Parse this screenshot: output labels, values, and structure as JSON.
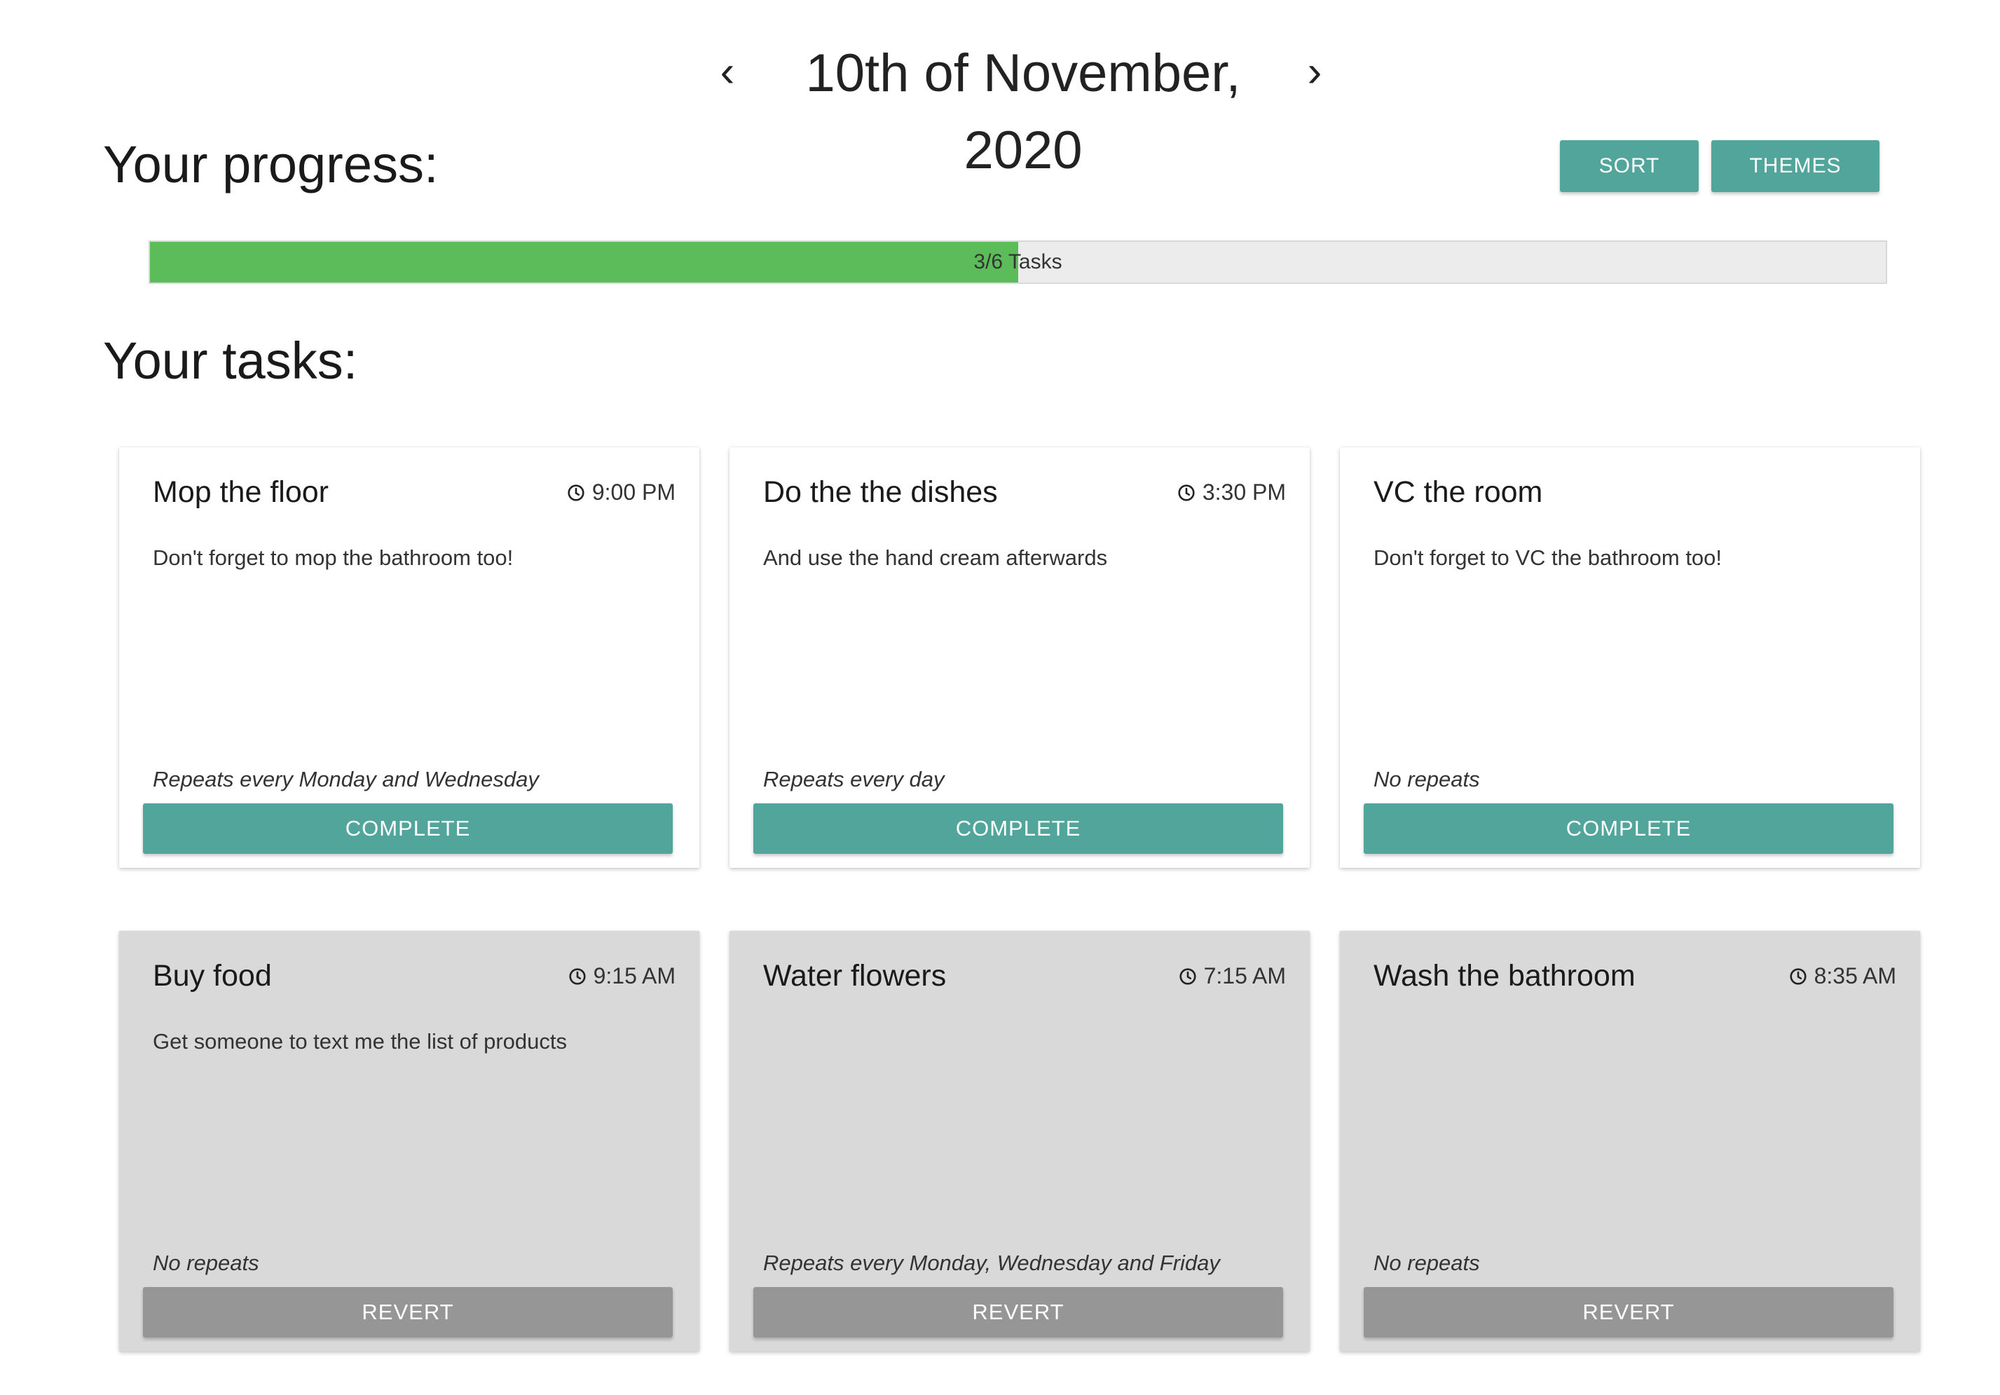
{
  "header": {
    "date": "10th of November, 2020",
    "prev_glyph": "‹",
    "next_glyph": "›"
  },
  "progress": {
    "title": "Your progress:",
    "label": "3/6 Tasks",
    "completed": 3,
    "total": 6,
    "fill_color": "#5cbc5a"
  },
  "toolbar": {
    "sort_label": "SORT",
    "themes_label": "THEMES",
    "accent_color": "#52a59b"
  },
  "tasks": {
    "title": "Your tasks:",
    "items": [
      {
        "title": "Mop the floor",
        "time": "9:00 PM",
        "description": "Don't forget to mop the bathroom too!",
        "repeat": "Repeats every Monday and Wednesday",
        "button": "COMPLETE",
        "done": false
      },
      {
        "title": "Do the the dishes",
        "time": "3:30 PM",
        "description": "And use the hand cream afterwards",
        "repeat": "Repeats every day",
        "button": "COMPLETE",
        "done": false
      },
      {
        "title": "VC the room",
        "time": "",
        "description": "Don't forget to VC the bathroom too!",
        "repeat": "No repeats",
        "button": "COMPLETE",
        "done": false
      },
      {
        "title": "Buy food",
        "time": "9:15 AM",
        "description": "Get someone to text me the list of products",
        "repeat": "No repeats",
        "button": "REVERT",
        "done": true
      },
      {
        "title": "Water flowers",
        "time": "7:15 AM",
        "description": "",
        "repeat": "Repeats every Monday, Wednesday and Friday",
        "button": "REVERT",
        "done": true
      },
      {
        "title": "Wash the bathroom",
        "time": "8:35 AM",
        "description": "",
        "repeat": "No repeats",
        "button": "REVERT",
        "done": true
      }
    ]
  }
}
